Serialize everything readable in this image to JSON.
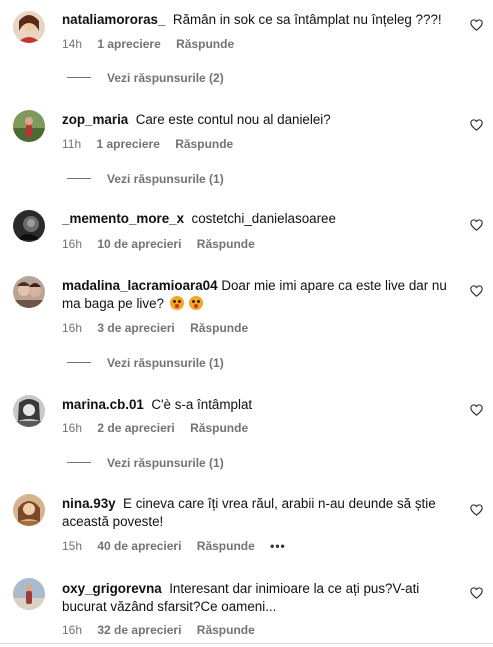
{
  "comments": [
    {
      "username": "nataliamororas_",
      "text": "Rămân in sok ce sa întâmplat nu înțeleg ???!",
      "time": "14h",
      "likes": "1 apreciere",
      "reply": "Răspunde",
      "view_replies": "Vezi răspunsurile (2)",
      "avatar_colors": [
        "#c0392b",
        "#8e2b20"
      ]
    },
    {
      "username": "zop_maria",
      "text": "Care este contul nou al danielei?",
      "time": "11h",
      "likes": "1 apreciere",
      "reply": "Răspunde",
      "view_replies": "Vezi răspunsurile (1)",
      "avatar_colors": [
        "#6b8e4e",
        "#3f5a2c"
      ]
    },
    {
      "username": "_memento_more_x",
      "text": "costetchi_danielasoaree",
      "time": "16h",
      "likes": "10 de aprecieri",
      "reply": "Răspunde",
      "avatar_colors": [
        "#555555",
        "#1a1a1a"
      ]
    },
    {
      "username": "madalina_lacramioara04",
      "text": "Doar mie imi apare ca este live dar nu ma baga pe live?",
      "time": "16h",
      "likes": "3 de aprecieri",
      "reply": "Răspunde",
      "view_replies": "Vezi răspunsurile (1)",
      "avatar_colors": [
        "#b79c8c",
        "#7a5b4d"
      ]
    },
    {
      "username": "marina.cb.01",
      "text": "C'è s-a întâmplat",
      "time": "16h",
      "likes": "2 de aprecieri",
      "reply": "Răspunde",
      "view_replies": "Vezi răspunsurile (1)",
      "avatar_colors": [
        "#9a9a9a",
        "#4a4a4a"
      ]
    },
    {
      "username": "nina.93y",
      "text": "E cineva care îți vrea răul, arabii n-au deunde să știe această poveste!",
      "time": "15h",
      "likes": "40 de aprecieri",
      "reply": "Răspunde",
      "more": "•••",
      "avatar_colors": [
        "#c98d5e",
        "#7d4f2c"
      ]
    },
    {
      "username": "oxy_grigorevna",
      "text": "Interesant dar inimioare la ce ați pus?V-ati bucurat văzând sfarsit?Ce oameni...",
      "time": "16h",
      "likes": "32 de aprecieri",
      "reply": "Răspunde",
      "avatar_colors": [
        "#8fa4b8",
        "#9b3b3b"
      ]
    }
  ],
  "icons": {
    "like": "heart-outline-icon",
    "emoji": "astonished-face-emoji"
  }
}
